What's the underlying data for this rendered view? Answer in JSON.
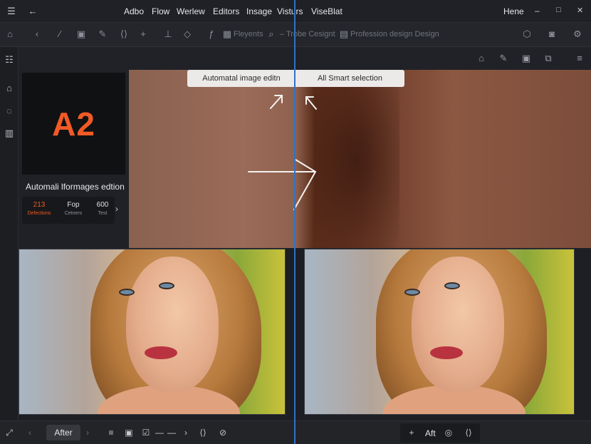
{
  "menubar": {
    "items": [
      "Adbo",
      "Flow",
      "Werlew",
      "Editors",
      "Insage",
      "Visturs",
      "ViseBlat"
    ],
    "right_label": "Hene",
    "back_icon": "arrow-left-icon",
    "min_glyph": "–",
    "max_glyph": "□",
    "close_glyph": "✕"
  },
  "toolbar": {
    "texts": [
      "Fleyents",
      "– Trobe Cesignt",
      "Profession design  Design"
    ]
  },
  "panel": {
    "logo_text": "A2",
    "title": "Automali lformages edtion",
    "stats": [
      {
        "value": "213",
        "label": "Defections"
      },
      {
        "value": "Fop",
        "label": "Cetners"
      },
      {
        "value": "600",
        "label": "Test"
      }
    ]
  },
  "canvas": {
    "tag_left": "Automatal image editn",
    "tag_right": "All Smart selection"
  },
  "bottombar": {
    "after_label": "After",
    "aft_label": "Aft"
  },
  "colors": {
    "accent": "#f05a26",
    "divider": "#2f73c6",
    "background": "#1d1f24"
  }
}
